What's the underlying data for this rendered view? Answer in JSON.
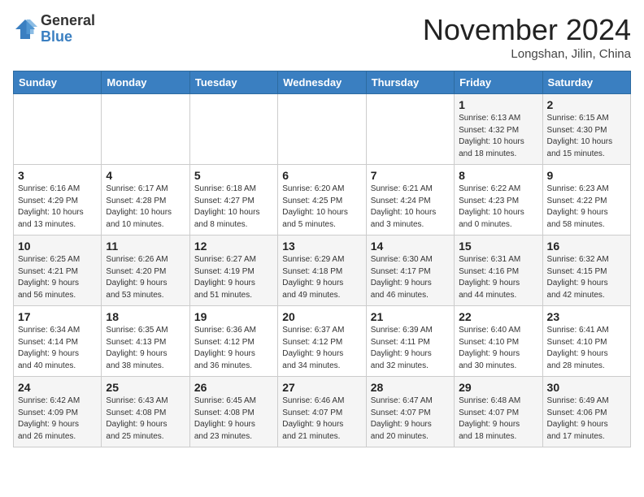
{
  "logo": {
    "line1": "General",
    "line2": "Blue"
  },
  "title": "November 2024",
  "location": "Longshan, Jilin, China",
  "weekdays": [
    "Sunday",
    "Monday",
    "Tuesday",
    "Wednesday",
    "Thursday",
    "Friday",
    "Saturday"
  ],
  "weeks": [
    [
      {
        "day": "",
        "info": ""
      },
      {
        "day": "",
        "info": ""
      },
      {
        "day": "",
        "info": ""
      },
      {
        "day": "",
        "info": ""
      },
      {
        "day": "",
        "info": ""
      },
      {
        "day": "1",
        "info": "Sunrise: 6:13 AM\nSunset: 4:32 PM\nDaylight: 10 hours\nand 18 minutes."
      },
      {
        "day": "2",
        "info": "Sunrise: 6:15 AM\nSunset: 4:30 PM\nDaylight: 10 hours\nand 15 minutes."
      }
    ],
    [
      {
        "day": "3",
        "info": "Sunrise: 6:16 AM\nSunset: 4:29 PM\nDaylight: 10 hours\nand 13 minutes."
      },
      {
        "day": "4",
        "info": "Sunrise: 6:17 AM\nSunset: 4:28 PM\nDaylight: 10 hours\nand 10 minutes."
      },
      {
        "day": "5",
        "info": "Sunrise: 6:18 AM\nSunset: 4:27 PM\nDaylight: 10 hours\nand 8 minutes."
      },
      {
        "day": "6",
        "info": "Sunrise: 6:20 AM\nSunset: 4:25 PM\nDaylight: 10 hours\nand 5 minutes."
      },
      {
        "day": "7",
        "info": "Sunrise: 6:21 AM\nSunset: 4:24 PM\nDaylight: 10 hours\nand 3 minutes."
      },
      {
        "day": "8",
        "info": "Sunrise: 6:22 AM\nSunset: 4:23 PM\nDaylight: 10 hours\nand 0 minutes."
      },
      {
        "day": "9",
        "info": "Sunrise: 6:23 AM\nSunset: 4:22 PM\nDaylight: 9 hours\nand 58 minutes."
      }
    ],
    [
      {
        "day": "10",
        "info": "Sunrise: 6:25 AM\nSunset: 4:21 PM\nDaylight: 9 hours\nand 56 minutes."
      },
      {
        "day": "11",
        "info": "Sunrise: 6:26 AM\nSunset: 4:20 PM\nDaylight: 9 hours\nand 53 minutes."
      },
      {
        "day": "12",
        "info": "Sunrise: 6:27 AM\nSunset: 4:19 PM\nDaylight: 9 hours\nand 51 minutes."
      },
      {
        "day": "13",
        "info": "Sunrise: 6:29 AM\nSunset: 4:18 PM\nDaylight: 9 hours\nand 49 minutes."
      },
      {
        "day": "14",
        "info": "Sunrise: 6:30 AM\nSunset: 4:17 PM\nDaylight: 9 hours\nand 46 minutes."
      },
      {
        "day": "15",
        "info": "Sunrise: 6:31 AM\nSunset: 4:16 PM\nDaylight: 9 hours\nand 44 minutes."
      },
      {
        "day": "16",
        "info": "Sunrise: 6:32 AM\nSunset: 4:15 PM\nDaylight: 9 hours\nand 42 minutes."
      }
    ],
    [
      {
        "day": "17",
        "info": "Sunrise: 6:34 AM\nSunset: 4:14 PM\nDaylight: 9 hours\nand 40 minutes."
      },
      {
        "day": "18",
        "info": "Sunrise: 6:35 AM\nSunset: 4:13 PM\nDaylight: 9 hours\nand 38 minutes."
      },
      {
        "day": "19",
        "info": "Sunrise: 6:36 AM\nSunset: 4:12 PM\nDaylight: 9 hours\nand 36 minutes."
      },
      {
        "day": "20",
        "info": "Sunrise: 6:37 AM\nSunset: 4:12 PM\nDaylight: 9 hours\nand 34 minutes."
      },
      {
        "day": "21",
        "info": "Sunrise: 6:39 AM\nSunset: 4:11 PM\nDaylight: 9 hours\nand 32 minutes."
      },
      {
        "day": "22",
        "info": "Sunrise: 6:40 AM\nSunset: 4:10 PM\nDaylight: 9 hours\nand 30 minutes."
      },
      {
        "day": "23",
        "info": "Sunrise: 6:41 AM\nSunset: 4:10 PM\nDaylight: 9 hours\nand 28 minutes."
      }
    ],
    [
      {
        "day": "24",
        "info": "Sunrise: 6:42 AM\nSunset: 4:09 PM\nDaylight: 9 hours\nand 26 minutes."
      },
      {
        "day": "25",
        "info": "Sunrise: 6:43 AM\nSunset: 4:08 PM\nDaylight: 9 hours\nand 25 minutes."
      },
      {
        "day": "26",
        "info": "Sunrise: 6:45 AM\nSunset: 4:08 PM\nDaylight: 9 hours\nand 23 minutes."
      },
      {
        "day": "27",
        "info": "Sunrise: 6:46 AM\nSunset: 4:07 PM\nDaylight: 9 hours\nand 21 minutes."
      },
      {
        "day": "28",
        "info": "Sunrise: 6:47 AM\nSunset: 4:07 PM\nDaylight: 9 hours\nand 20 minutes."
      },
      {
        "day": "29",
        "info": "Sunrise: 6:48 AM\nSunset: 4:07 PM\nDaylight: 9 hours\nand 18 minutes."
      },
      {
        "day": "30",
        "info": "Sunrise: 6:49 AM\nSunset: 4:06 PM\nDaylight: 9 hours\nand 17 minutes."
      }
    ]
  ]
}
